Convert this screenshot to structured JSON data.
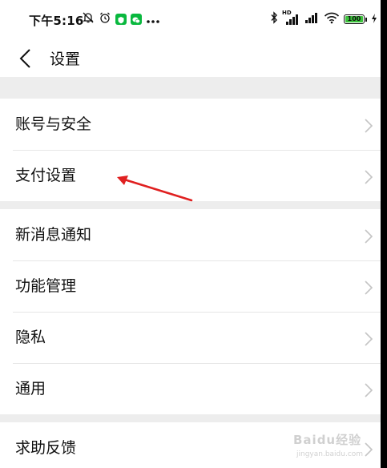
{
  "status_bar": {
    "time": "下午5:16",
    "network_label": "HD",
    "battery_level": "100",
    "battery_color": "#3cc23c",
    "icons": [
      "bell-off-icon",
      "alarm-icon",
      "security-badge-icon",
      "wechat-icon",
      "more-dots-icon",
      "bluetooth-icon",
      "signal-icon",
      "signal-icon",
      "wifi-icon",
      "battery-icon",
      "charging-icon"
    ]
  },
  "nav": {
    "title": "设置",
    "back_icon": "chevron-left-icon"
  },
  "settings": {
    "group1": [
      {
        "label": "账号与安全"
      },
      {
        "label": "支付设置"
      }
    ],
    "group2": [
      {
        "label": "新消息通知"
      },
      {
        "label": "功能管理"
      },
      {
        "label": "隐私"
      },
      {
        "label": "通用"
      }
    ],
    "group3": [
      {
        "label": "求助反馈"
      }
    ]
  },
  "annotation": {
    "arrow_color": "#e02020",
    "points_to": "支付设置"
  },
  "watermark": {
    "text": "Baidu经验",
    "url": "jingyan.baidu.com"
  },
  "colors": {
    "page_background": "#ededed",
    "row_background": "#ffffff",
    "badge_green": "#09b83e"
  }
}
